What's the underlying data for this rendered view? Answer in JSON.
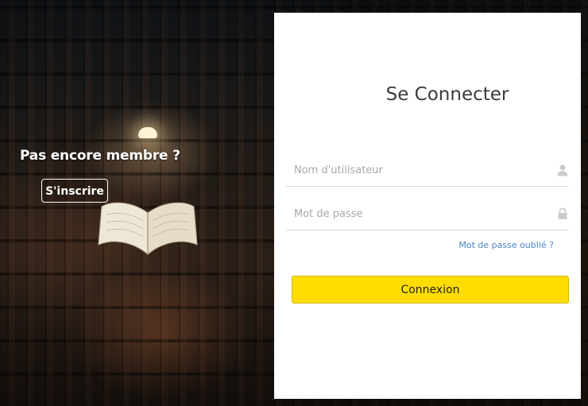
{
  "left_panel": {
    "background_description": "library-background-image",
    "title": "Pas encore membre ?",
    "signup_label": "S'inscrire"
  },
  "login_card": {
    "title": "Se Connecter",
    "username": {
      "placeholder": "Nom d'utilisateur",
      "value": "",
      "icon": "user-icon"
    },
    "password": {
      "placeholder": "Mot de passe",
      "value": "",
      "icon": "lock-icon"
    },
    "forgot_label": "Mot de passe oublié ?",
    "submit_label": "Connexion"
  },
  "colors": {
    "accent_button": "#ffdd00",
    "link": "#4a86c5",
    "card_background": "#ffffff",
    "icon": "#cccccc"
  }
}
